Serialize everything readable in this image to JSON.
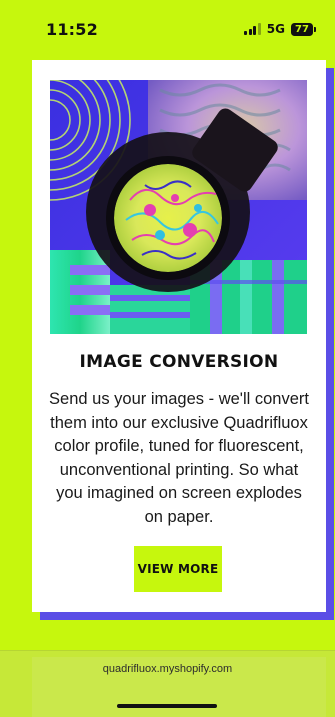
{
  "status_bar": {
    "time": "11:52",
    "network": "5G",
    "battery": "77"
  },
  "card": {
    "image_alt_icon": "magnifying-loupe-psychedelic-image",
    "title": "IMAGE CONVERSION",
    "description": "Send us your images - we'll convert them into our exclusive Quadrifluox color profile, tuned for fluorescent, unconventional printing. So what you imagined on screen explodes on paper.",
    "button_label": "VIEW MORE"
  },
  "browser": {
    "url": "quadrifluox.myshopify.com"
  },
  "colors": {
    "background": "#c6f70d",
    "accent_shadow": "#5b4ee6",
    "card": "#ffffff",
    "button": "#c6f70d"
  }
}
